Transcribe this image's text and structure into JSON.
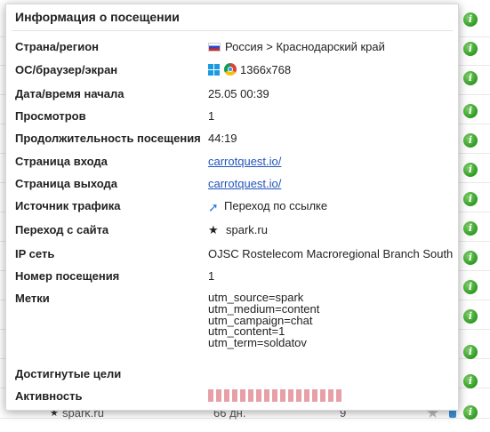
{
  "popup": {
    "title": "Информация о посещении",
    "rows": [
      {
        "label": "Страна/регион",
        "value": "Россия > Краснодарский край"
      },
      {
        "label": "ОС/браузер/экран",
        "value": "1366x768"
      },
      {
        "label": "Дата/время начала",
        "value": "25.05 00:39"
      },
      {
        "label": "Просмотров",
        "value": "1"
      },
      {
        "label": "Продолжительность посещения",
        "value": "44:19"
      },
      {
        "label": "Страница входа",
        "value": "carrotquest.io/"
      },
      {
        "label": "Страница выхода",
        "value": "carrotquest.io/"
      },
      {
        "label": "Источник трафика",
        "value": "Переход по ссылке"
      },
      {
        "label": "Переход с сайта",
        "value": "spark.ru"
      },
      {
        "label": "IP сеть",
        "value": "OJSC Rostelecom Macroregional Branch South"
      },
      {
        "label": "Номер посещения",
        "value": "1"
      },
      {
        "label": "Метки",
        "value": ""
      },
      {
        "label": "Достигнутые цели",
        "value": ""
      },
      {
        "label": "Активность",
        "value": ""
      }
    ],
    "tags": [
      "utm_source=spark",
      "utm_medium=content",
      "utm_campaign=chat",
      "utm_content=1",
      "utm_term=soldatov"
    ],
    "activity_segments": 17,
    "activity_color": "#e8a0a8"
  },
  "background": {
    "row_site": "spark.ru",
    "row_days": "66 дн.",
    "row_count": "9"
  },
  "icons": {
    "info": "info-icon",
    "flag": "russia-flag-icon",
    "os": "windows-icon",
    "browser": "chrome-icon",
    "traffic": "link-arrow-icon",
    "referrer": "star-icon"
  },
  "colors": {
    "link": "#2255bb",
    "info_green": "#2f9a22"
  }
}
